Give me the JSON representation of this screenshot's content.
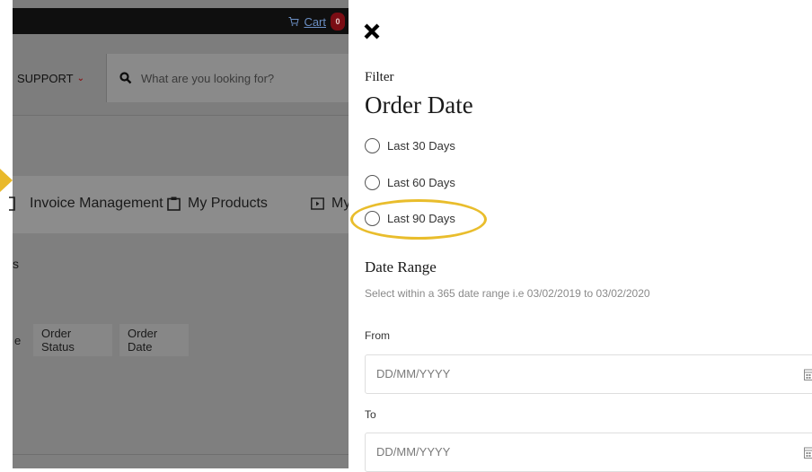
{
  "header": {
    "cart_label": "Cart",
    "cart_count": "0"
  },
  "nav": {
    "support_label": "SUPPORT",
    "search_placeholder": "What are you looking for?"
  },
  "tabs": [
    {
      "label": "Invoice Management"
    },
    {
      "label": "My Products"
    },
    {
      "label": "My"
    }
  ],
  "background_text": {
    "section_fragment": "s",
    "column_fragment": "e"
  },
  "columns": [
    {
      "label": "Order Status"
    },
    {
      "label": "Order Date"
    }
  ],
  "filter": {
    "heading": "Filter",
    "order_date_title": "Order Date",
    "options": [
      {
        "label": "Last 30 Days",
        "selected": false
      },
      {
        "label": "Last 60 Days",
        "selected": false
      },
      {
        "label": "Last 90 Days",
        "selected": false
      }
    ],
    "date_range_title": "Date Range",
    "date_range_hint": "Select within a 365 date range i.e 03/02/2019 to 03/02/2020",
    "from_label": "From",
    "from_placeholder": "DD/MM/YYYY",
    "to_label": "To",
    "to_placeholder": "DD/MM/YYYY"
  },
  "colors": {
    "accent_red": "#7a0d14",
    "highlight_yellow": "#e9bd2c",
    "overlay_gray": "#7d7d7d"
  }
}
